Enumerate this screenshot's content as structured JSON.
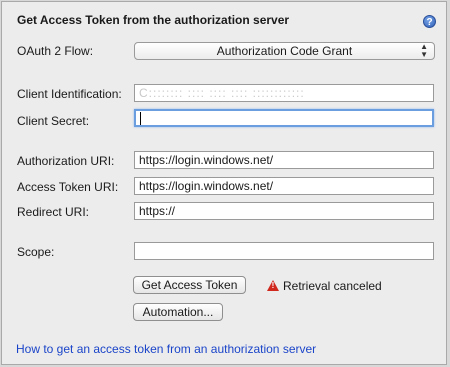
{
  "dialog": {
    "title": "Get Access Token from the authorization server",
    "help_icon": "help-icon"
  },
  "oauth_flow": {
    "label": "OAuth 2 Flow:",
    "selected": "Authorization Code Grant"
  },
  "client_id": {
    "label": "Client Identification:",
    "value": "C::::::::  ::::  ::::  ::::  ::::::::::::"
  },
  "client_secret": {
    "label": "Client Secret:",
    "value": ""
  },
  "auth_uri": {
    "label": "Authorization URI:",
    "value": "https://login.windows.net/"
  },
  "token_uri": {
    "label": "Access Token URI:",
    "value": "https://login.windows.net/"
  },
  "redirect_uri": {
    "label": "Redirect URI:",
    "value": "https://"
  },
  "scope": {
    "label": "Scope:",
    "value": ""
  },
  "actions": {
    "get_token": "Get Access Token",
    "automation": "Automation..."
  },
  "status": {
    "text": "Retrieval canceled",
    "color": "#d1281e"
  },
  "help_link": "How to get an access token from an authorization server"
}
